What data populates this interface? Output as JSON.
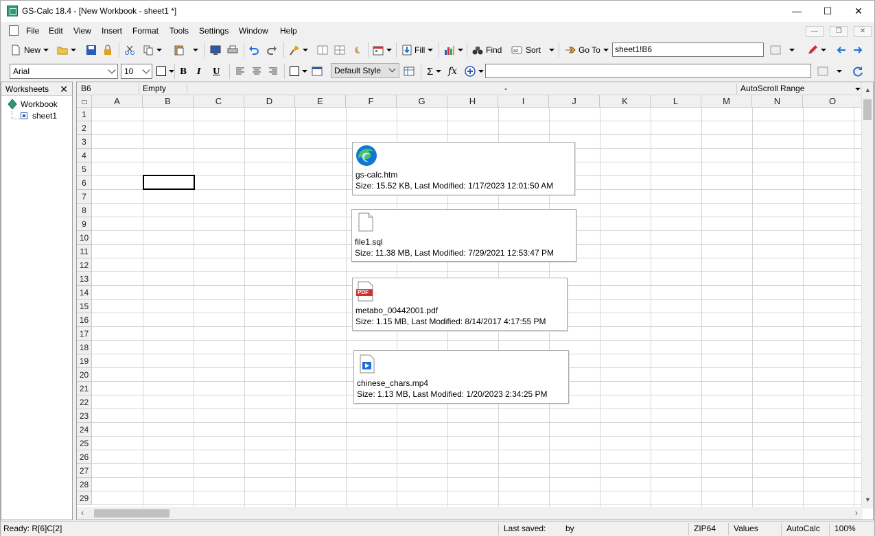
{
  "window": {
    "title": "GS-Calc 18.4 - [New Workbook - sheet1 *]",
    "controls": {
      "minimize": "—",
      "maximize": "☐",
      "close": "✕"
    }
  },
  "menu": {
    "items": [
      "File",
      "Edit",
      "View",
      "Insert",
      "Format",
      "Tools",
      "Settings",
      "Window",
      "Help"
    ],
    "mdi": {
      "minimize": "—",
      "restore": "❐",
      "close": "✕"
    }
  },
  "toolbar1": {
    "new": "New",
    "fill": "Fill",
    "find": "Find",
    "sort": "Sort",
    "goto": "Go To",
    "goto_value": "sheet1!B6"
  },
  "toolbar2": {
    "font": "Arial",
    "size": "10",
    "bold": "B",
    "italic": "I",
    "underline": "U",
    "style": "Default Style",
    "sigma": "Σ",
    "fx": "fx",
    "formula_value": ""
  },
  "worksheets_panel": {
    "title": "Worksheets",
    "close": "✕",
    "workbook": "Workbook",
    "sheet": "sheet1"
  },
  "infobar": {
    "cell_ref": "B6",
    "cell_state": "Empty",
    "mid": "-",
    "autoscroll": "AutoScroll Range"
  },
  "columns": [
    "A",
    "B",
    "C",
    "D",
    "E",
    "F",
    "G",
    "H",
    "I",
    "J",
    "K",
    "L",
    "M",
    "N",
    "O"
  ],
  "rows": [
    "1",
    "2",
    "3",
    "4",
    "5",
    "6",
    "7",
    "8",
    "9",
    "10",
    "11",
    "12",
    "13",
    "14",
    "15",
    "16",
    "17",
    "18",
    "19",
    "20",
    "21",
    "22",
    "23",
    "24",
    "25",
    "26",
    "27",
    "28",
    "29"
  ],
  "files": [
    {
      "name": "gs-calc.htm",
      "meta": "Size: 15.52 KB, Last Modified: 1/17/2023 12:01:50 AM",
      "icon": "edge-browser-icon"
    },
    {
      "name": "file1.sql",
      "meta": "Size: 11.38 MB, Last Modified: 7/29/2021 12:53:47 PM",
      "icon": "blank-file-icon"
    },
    {
      "name": "metabo_00442001.pdf",
      "meta": "Size: 1.15 MB, Last Modified: 8/14/2017 4:17:55 PM",
      "icon": "pdf-file-icon",
      "icon_label": "PDF"
    },
    {
      "name": "chinese_chars.mp4",
      "meta": "Size: 1.13 MB, Last Modified: 1/20/2023 2:34:25 PM",
      "icon": "video-file-icon"
    }
  ],
  "status": {
    "ready": "Ready:  R[6]C[2]",
    "last_saved": "Last saved:",
    "by": "by",
    "zip": "ZIP64",
    "values": "Values",
    "autocalc": "AutoCalc",
    "zoom": "100%"
  },
  "colors": {
    "accent_blue": "#1e6fd9",
    "pdf_red": "#d32f2f",
    "gridline": "#d4d4d4"
  }
}
